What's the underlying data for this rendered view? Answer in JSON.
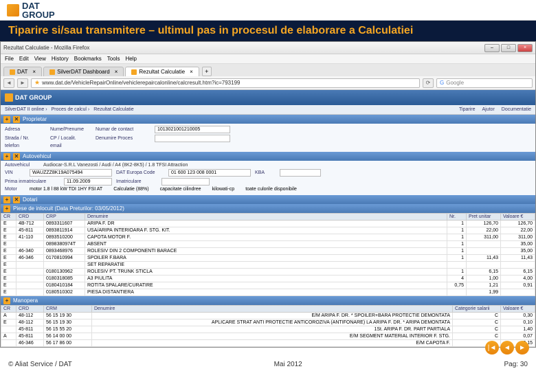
{
  "logo": {
    "top": "DAT",
    "bottom": "GROUP"
  },
  "slideTitle": "Tiparire si/sau transmitere – ultimul pas in procesul de elaborare a Calculatiei",
  "browser": {
    "title": "Rezultat Calculatie - Mozilla Firefox",
    "menu": [
      "File",
      "Edit",
      "View",
      "History",
      "Bookmarks",
      "Tools",
      "Help"
    ],
    "tabs": [
      {
        "label": "DAT",
        "active": false
      },
      {
        "label": "SilverDAT Dashboard",
        "active": false
      },
      {
        "label": "Rezultat Calculatie",
        "active": true
      }
    ],
    "url": "www.dat.de/VehicleRepairOnline/vehiclerepaircalonline/calcresult.htm?ic=793199",
    "searchPlaceholder": "Google",
    "pageLogo": "DAT GROUP"
  },
  "crumbs": {
    "left": [
      "SilverDAT II online",
      "Proces de calcul",
      "Rezultat Calculatie"
    ],
    "right": [
      "Tiparire",
      "Ajutor",
      "Documentatie"
    ]
  },
  "sections": {
    "proprietar": {
      "title": "Proprietar",
      "labels": [
        "Adresa",
        "Nume/Prenume",
        "Numar de contact",
        "Strada / Nr.",
        "CP / Localit.",
        "Denumire Proces",
        "telefon",
        "email"
      ],
      "contact": "1013021001210005"
    },
    "autovehicul": {
      "title": "Autovehicul",
      "desc": "Audiocar-S.R.L Vanezosti / Audi / A4 (8K2-8K5) / 1.8 TFSI Attraction",
      "vinLabel": "VIN",
      "vin": "WAUZZZ8K19A075494",
      "datEuroLabel": "DAT Europa Code",
      "datEuroVal": "01 600 123 008 0001",
      "primaLabel": "Prima inmatriculare",
      "primaVal": "11.09.2009",
      "kbaLabel": "KBA",
      "imatricLabel": "Imatriculare",
      "motorLabel": "motor 1.8 l 88 kW TDI 1HY FSI AT",
      "calcLabel": "Calculatie (88%)",
      "cil": "capacitate cilindree",
      "kw": "kilowati-cp",
      "culoare": "toate culorile disponibile",
      "nr": ""
    },
    "dotari": {
      "title": "Dotari"
    },
    "piese": {
      "title": "Piese de inlocuit (Data Preturilor: 03/05/2012)",
      "headers": [
        "CR",
        "CRD",
        "CRP",
        "Denumire",
        "Nr.",
        "Pret unitar",
        "Valoare €"
      ],
      "rows": [
        [
          "E",
          "4B-712",
          "0893311607",
          "ARIPA F. DR",
          "1",
          "126,70",
          "126,70"
        ],
        [
          "E",
          "45-811",
          "0893811914",
          "USA/ARIPA INTERIOARA F. STG. KIT.",
          "1",
          "22,00",
          "22,00"
        ],
        [
          "E",
          "41-110",
          "0893510200",
          "CAPOTA MOTOR F.",
          "1",
          "311,00",
          "311,00"
        ],
        [
          "E",
          "",
          "0898380974T",
          "ABSENT",
          "1",
          "",
          "35,00"
        ],
        [
          "E",
          "46-340",
          "0893468976",
          "ROLESIV DIN 2 COMPONENTI BARACE",
          "1",
          "",
          "35,00"
        ],
        [
          "E",
          "46-346",
          "0170810994",
          "SPOILER F.BARA",
          "1",
          "11,43",
          "11,43"
        ],
        [
          "E",
          "",
          "",
          "SET REPARATIE",
          "",
          "",
          ""
        ],
        [
          "E",
          "",
          "0180130962",
          "ROLESIV PT. TRUNK STICLA",
          "1",
          "6,15",
          "6,15"
        ],
        [
          "E",
          "",
          "0180318085",
          "A3 PIULITA",
          "4",
          "1,00",
          "4,00"
        ],
        [
          "E",
          "",
          "0180410184",
          "ROTITA SPALARE/CURATIRE",
          "0,75",
          "1,21",
          "0,91"
        ],
        [
          "E",
          "",
          "0180510302",
          "PIESA DISTANTIERA",
          "",
          "1,99",
          ""
        ]
      ]
    },
    "manopera": {
      "title": "Manopera",
      "headers": [
        "CR",
        "CRD",
        "CRM",
        "Denumire",
        "Categorie salarii",
        "Valoare €"
      ],
      "rows": [
        [
          "A",
          "48-112",
          "56 15 19 30",
          "E/M ARIPA F. DR. * SPOILER+BARA PROTECTIE DEMONTATA",
          "C",
          "0,30"
        ],
        [
          "E",
          "48-112",
          "56 15 19 30",
          "APLICARE STRAT ANTI PROTECTIE ANTICOROZIVA (ANTIFONARE) LA ARIPA F. DR. * ARIPA DEMONTATA",
          "C",
          "0,10"
        ],
        [
          "",
          "45-811",
          "56 15 55 20",
          "1St. ARIPA F. DR. PART PARTIALA",
          "C",
          "1,40"
        ],
        [
          "A",
          "45-811",
          "56 14 00 00",
          "E/M SEGMENT MATERIAL INTERIOR F. STG.",
          "C",
          "0,07"
        ],
        [
          "",
          "46-346",
          "56 17 86 00",
          "E/M CAPOTA F.",
          "",
          "0,15"
        ]
      ]
    }
  },
  "footer": {
    "copyright": "© Aliat Service / DAT",
    "date": "Mai 2012",
    "pageLabel": "Pag:",
    "pageNum": "30"
  }
}
